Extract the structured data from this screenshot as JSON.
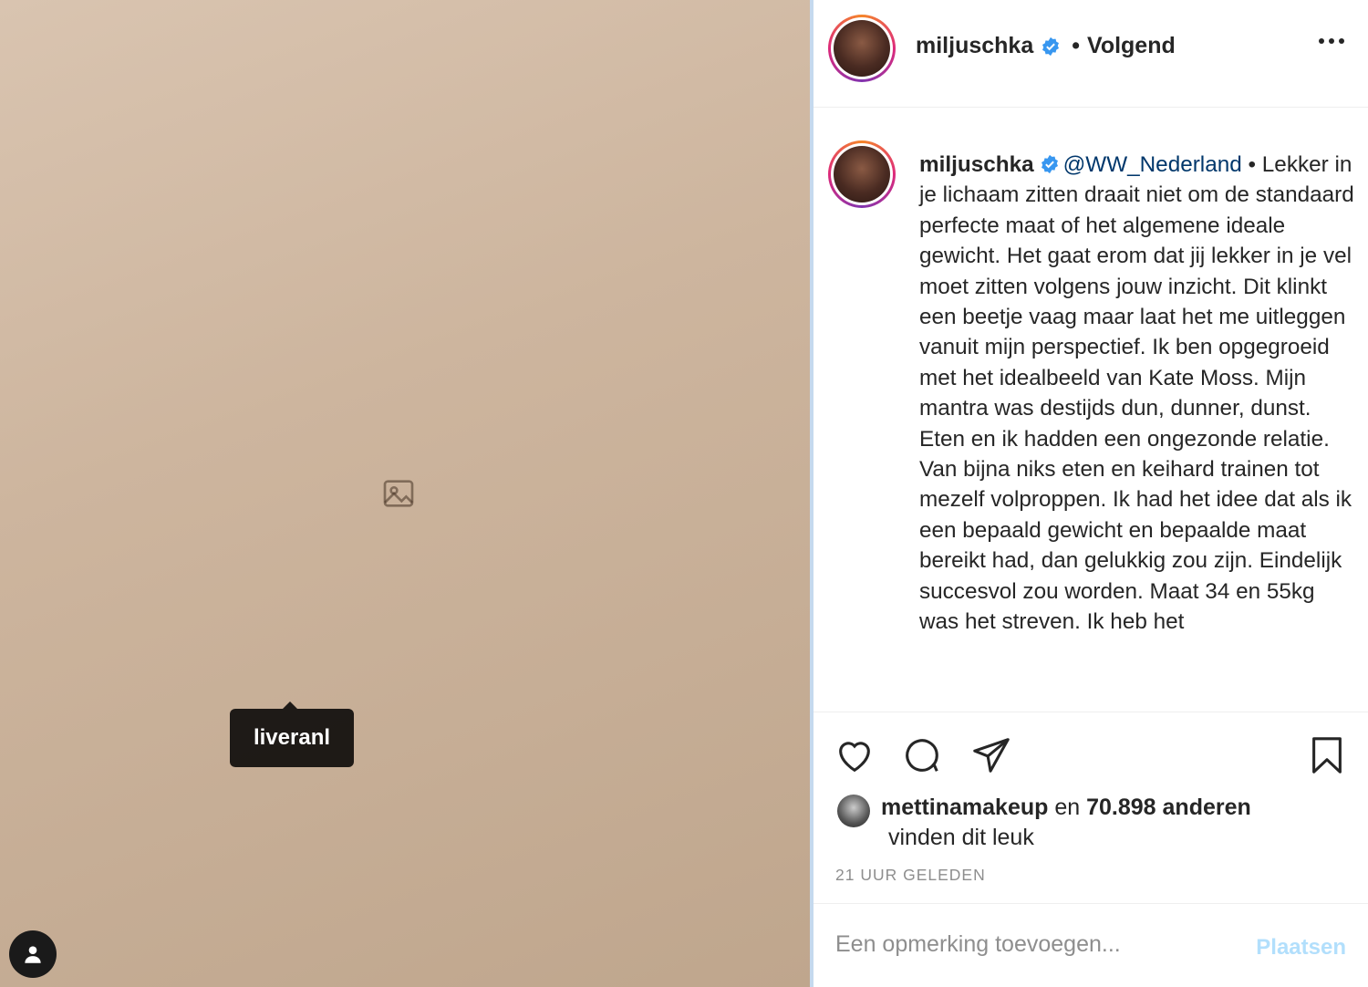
{
  "post": {
    "tag_label": "liveranl"
  },
  "header": {
    "username": "miljuschka",
    "separator": "•",
    "follow_status": "Volgend"
  },
  "caption": {
    "username": "miljuschka",
    "mention": "@WW_Nederland",
    "separator": "•",
    "text": "Lekker in je lichaam zitten draait niet om de standaard perfecte maat of het algemene ideale gewicht. Het gaat erom dat jij lekker in je vel moet zitten volgens jouw inzicht. Dit klinkt een beetje vaag maar laat het me uitleggen vanuit mijn perspectief. Ik ben opgegroeid met het idealbeeld van Kate Moss. Mijn mantra was destijds dun, dunner, dunst. Eten en ik hadden een ongezonde relatie. Van bijna niks eten en keihard trainen tot mezelf volproppen. Ik had het idee dat als ik een bepaald gewicht en bepaalde maat bereikt had, dan gelukkig zou zijn. Eindelijk succesvol zou worden. Maat 34 en 55kg was het streven. Ik heb het"
  },
  "likes": {
    "liker": "mettinamakeup",
    "conjunction": "en",
    "others": "70.898 anderen",
    "line2": "vinden dit leuk"
  },
  "timestamp": "21 UUR GELEDEN",
  "comment": {
    "placeholder": "Een opmerking toevoegen...",
    "post_label": "Plaatsen"
  },
  "colors": {
    "verified": "#3897f0",
    "mention": "#00376b",
    "post_button_disabled": "#b2dffc",
    "muted_text": "#8e8e8e"
  },
  "icons": [
    "verified-icon",
    "more-icon",
    "like-icon",
    "comment-icon",
    "share-icon",
    "save-icon",
    "user-tag-icon"
  ]
}
